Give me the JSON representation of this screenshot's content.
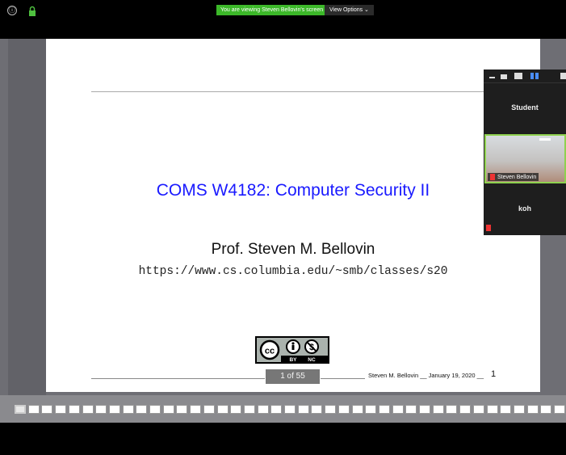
{
  "topbar": {
    "info_icon": "ⓘ",
    "share_banner": "You are viewing Steven Bellovin's screen",
    "view_options": "View Options ⌄"
  },
  "slide": {
    "title": "COMS W4182: Computer Security II",
    "author": "Prof. Steven M. Bellovin",
    "url": "https://www.cs.columbia.edu/~smb/classes/s20",
    "license_labels": [
      "BY",
      "NC"
    ],
    "page_indicator": "1 of 55",
    "footer_text": "Steven M. Bellovin __ January 19, 2020 __",
    "footer_page": "1"
  },
  "participants": {
    "tiles": [
      {
        "label": "Student"
      },
      {
        "label": "Steven Bellovin"
      },
      {
        "label": "koh"
      }
    ]
  },
  "thumbnails": {
    "count": 41
  },
  "colors": {
    "accent_green": "#3cb829",
    "title_blue": "#1a1aff"
  }
}
